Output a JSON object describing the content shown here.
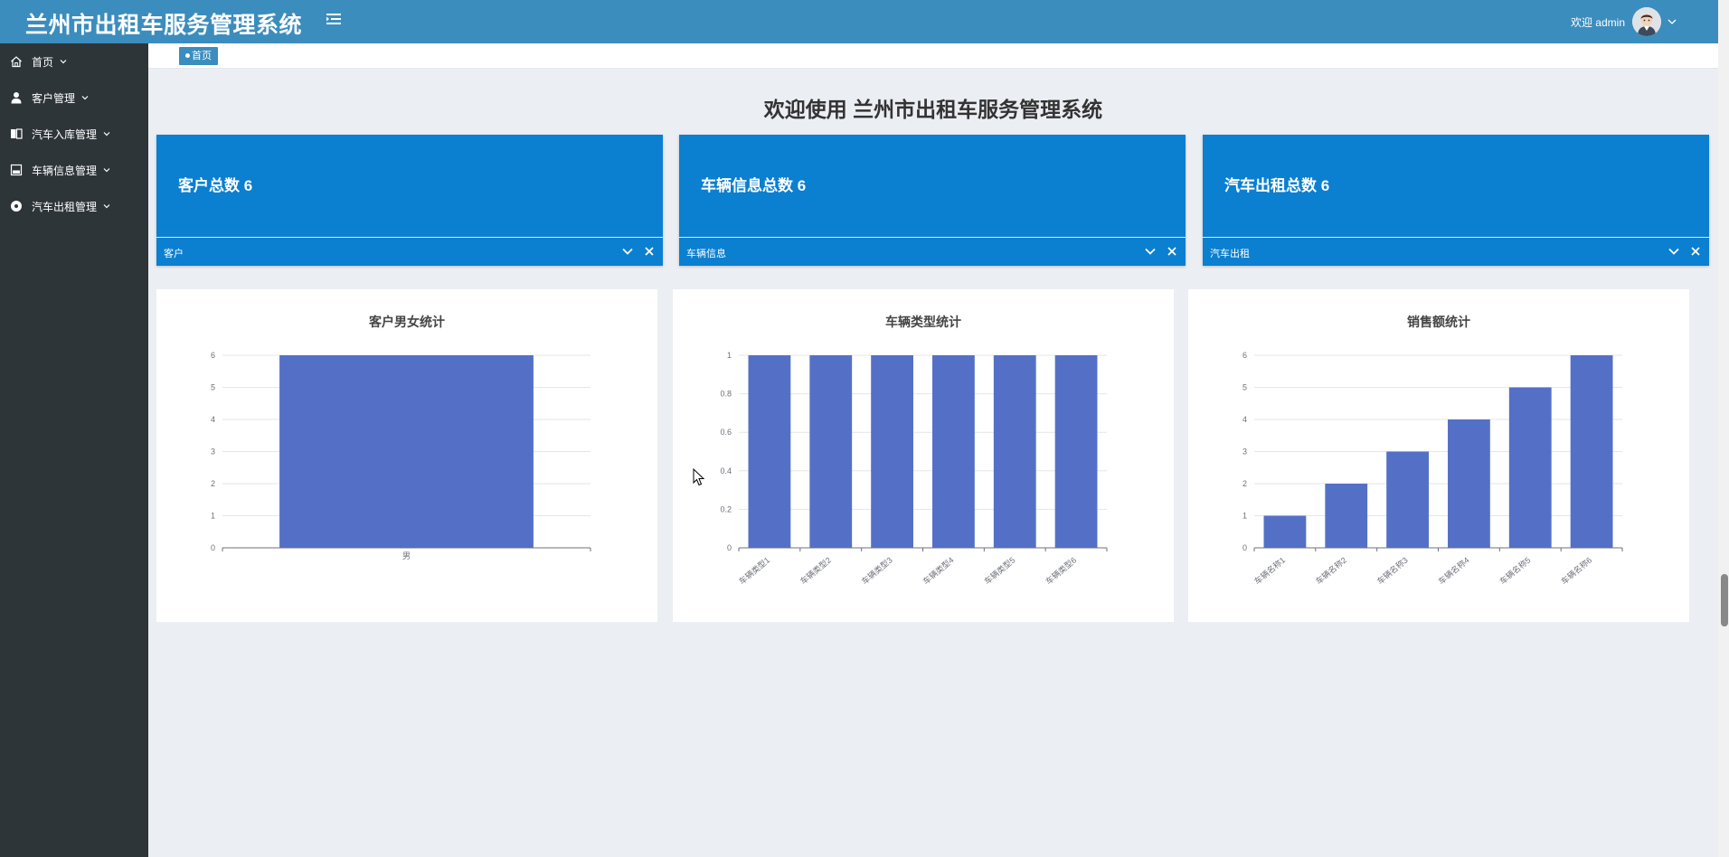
{
  "header": {
    "title": "兰州市出租车服务管理系统",
    "welcome": "欢迎 admin",
    "menu_toggle_icon": "menu-fold-icon",
    "avatar_icon": "user-avatar-icon"
  },
  "sidebar": {
    "items": [
      {
        "label": "首页",
        "icon": "home-icon"
      },
      {
        "label": "客户管理",
        "icon": "user-icon"
      },
      {
        "label": "汽车入库管理",
        "icon": "book-icon"
      },
      {
        "label": "车辆信息管理",
        "icon": "image-icon"
      },
      {
        "label": "汽车出租管理",
        "icon": "record-icon"
      }
    ]
  },
  "tabs": [
    {
      "label": "首页",
      "active": true
    }
  ],
  "main": {
    "welcome_title": "欢迎使用 兰州市出租车服务管理系统",
    "stat_cards": [
      {
        "text": "客户总数  6",
        "footer": "客户"
      },
      {
        "text": "车辆信息总数  6",
        "footer": "车辆信息"
      },
      {
        "text": "汽车出租总数  6",
        "footer": "汽车出租"
      }
    ]
  },
  "colors": {
    "header": "#3b8dbd",
    "sidebar": "#2e3539",
    "card": "#0b7fd0",
    "bar": "#5470c6",
    "background": "#ebeef3"
  },
  "chart_data": [
    {
      "type": "bar",
      "title": "客户男女统计",
      "categories": [
        "男"
      ],
      "values": [
        6
      ],
      "ylim": [
        0,
        6
      ],
      "yticks": [
        0,
        1,
        2,
        3,
        4,
        5,
        6
      ],
      "grid": true
    },
    {
      "type": "bar",
      "title": "车辆类型统计",
      "categories": [
        "车辆类型1",
        "车辆类型2",
        "车辆类型3",
        "车辆类型4",
        "车辆类型5",
        "车辆类型6"
      ],
      "values": [
        1,
        1,
        1,
        1,
        1,
        1
      ],
      "ylim": [
        0,
        1
      ],
      "yticks": [
        0,
        0.2,
        0.4,
        0.6,
        0.8,
        1
      ],
      "grid": true
    },
    {
      "type": "bar",
      "title": "销售额统计",
      "categories": [
        "车辆名称1",
        "车辆名称2",
        "车辆名称3",
        "车辆名称4",
        "车辆名称5",
        "车辆名称6"
      ],
      "values": [
        1,
        2,
        3,
        4,
        5,
        6
      ],
      "ylim": [
        0,
        6
      ],
      "yticks": [
        0,
        1,
        2,
        3,
        4,
        5,
        6
      ],
      "grid": true
    }
  ]
}
